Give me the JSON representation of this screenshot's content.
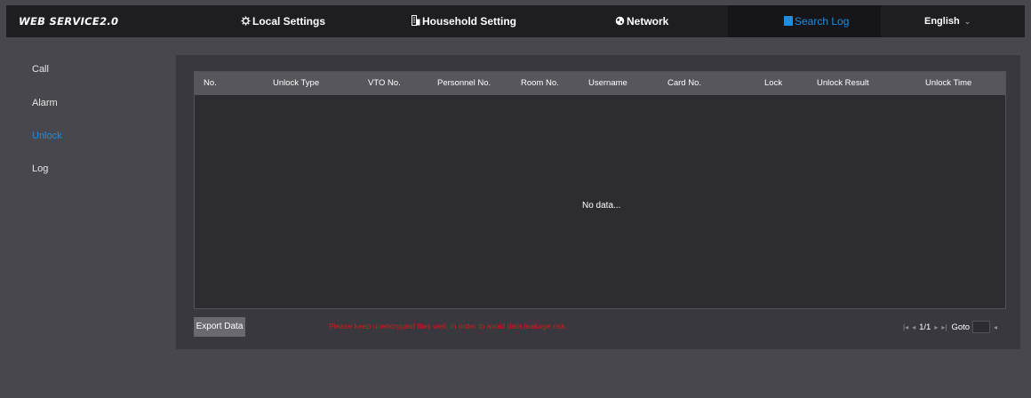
{
  "header": {
    "logo": "WEB SERVICE2.0",
    "nav": {
      "local_settings": "Local Settings",
      "household_setting": "Household Setting",
      "network": "Network",
      "search_log": "Search Log"
    },
    "language": "English",
    "colors": {
      "bar": "#1e1d22",
      "accent": "#1a8fe3"
    }
  },
  "sidebar": {
    "items": [
      {
        "label": "Call",
        "active": false
      },
      {
        "label": "Alarm",
        "active": false
      },
      {
        "label": "Unlock",
        "active": true
      },
      {
        "label": "Log",
        "active": false
      }
    ]
  },
  "table": {
    "columns": [
      "No.",
      "Unlock Type",
      "VTO No.",
      "Personnel No.",
      "Room No.",
      "Username",
      "Card No.",
      "Lock",
      "Unlock Result",
      "Unlock Time"
    ],
    "rows": [],
    "empty_text": "No data..."
  },
  "footer": {
    "export_label": "Export Data",
    "warning": "Please keep unencrypted files well, in order to avoid data leakage risk.",
    "pager": {
      "page": "1/1",
      "goto_label": "Goto",
      "goto_value": ""
    }
  },
  "icons": {
    "local_settings": "gear-icon",
    "household_setting": "building-icon",
    "network": "globe-icon",
    "search_log": "log-icon",
    "first_page": "first-page-icon",
    "prev_page": "prev-page-icon",
    "next_page": "next-page-icon",
    "last_page": "last-page-icon",
    "go": "go-icon"
  }
}
